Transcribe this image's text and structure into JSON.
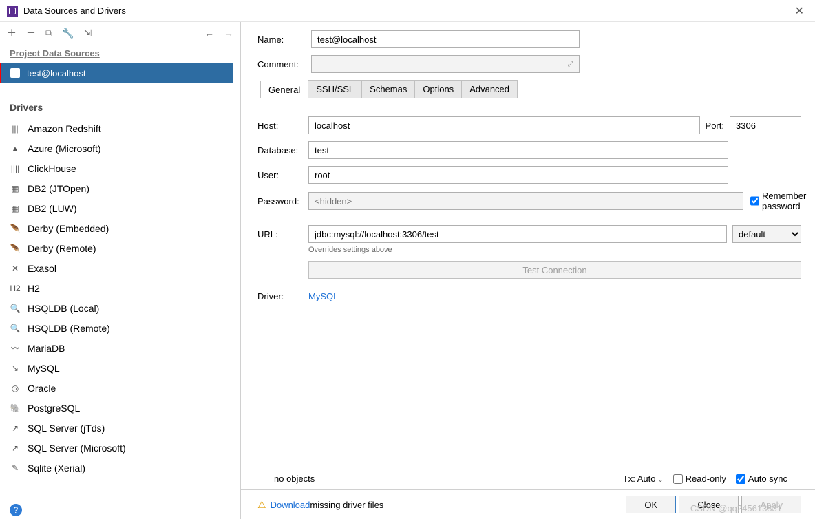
{
  "window": {
    "title": "Data Sources and Drivers"
  },
  "sidebar": {
    "project_header": "Project Data Sources",
    "selected_ds": "test@localhost",
    "drivers_header": "Drivers",
    "drivers": [
      "Amazon Redshift",
      "Azure (Microsoft)",
      "ClickHouse",
      "DB2 (JTOpen)",
      "DB2 (LUW)",
      "Derby (Embedded)",
      "Derby (Remote)",
      "Exasol",
      "H2",
      "HSQLDB (Local)",
      "HSQLDB (Remote)",
      "MariaDB",
      "MySQL",
      "Oracle",
      "PostgreSQL",
      "SQL Server (jTds)",
      "SQL Server (Microsoft)",
      "Sqlite (Xerial)"
    ]
  },
  "form": {
    "name_label": "Name:",
    "name_value": "test@localhost",
    "comment_label": "Comment:",
    "tabs": [
      "General",
      "SSH/SSL",
      "Schemas",
      "Options",
      "Advanced"
    ],
    "host_label": "Host:",
    "host_value": "localhost",
    "port_label": "Port:",
    "port_value": "3306",
    "db_label": "Database:",
    "db_value": "test",
    "user_label": "User:",
    "user_value": "root",
    "pwd_label": "Password:",
    "pwd_placeholder": "<hidden>",
    "remember": "Remember password",
    "url_label": "URL:",
    "url_value": "jdbc:mysql://localhost:3306/test",
    "url_mode": "default",
    "url_hint": "Overrides settings above",
    "test_btn": "Test Connection",
    "driver_label": "Driver:",
    "driver_link": "MySQL",
    "no_objects": "no objects",
    "tx": "Tx: Auto",
    "readonly": "Read-only",
    "autosync": "Auto sync"
  },
  "footer": {
    "download": "Download",
    "missing": " missing driver files",
    "ok": "OK",
    "close": "Close",
    "apply": "Apply"
  },
  "watermark": "CSDN @qq245613831"
}
